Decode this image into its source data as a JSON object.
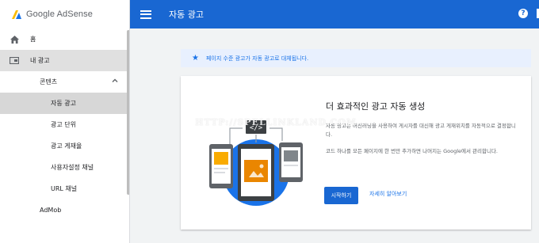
{
  "brand": {
    "name": "Google AdSense"
  },
  "topbar": {
    "title": "자동 광고",
    "help": "?"
  },
  "sidebar": {
    "items": [
      {
        "label": "홈"
      },
      {
        "label": "내 광고"
      },
      {
        "label": "콘텐츠"
      },
      {
        "label": "자동 광고"
      },
      {
        "label": "광고 단위"
      },
      {
        "label": "광고 게재율"
      },
      {
        "label": "사용자설정 채널"
      },
      {
        "label": "URL 채널"
      },
      {
        "label": "AdMob"
      }
    ]
  },
  "banner": {
    "text": "페이지 수준 광고가 자동 광고로 대체됩니다."
  },
  "card": {
    "title": "더 효과적인 광고 자동 생성",
    "desc1": "자동 광고는 머신러닝을 사용하여 게시자를 대신해 광고 게재위치를 자동적으로 결정합니다.",
    "desc2": "코드 하나를 모든 페이지에 한 번만 추가하면 나머지는 Google에서 관리합니다.",
    "start_label": "시작하기",
    "learn_label": "자세히 알아보기"
  },
  "watermark": "HTTP://SPELLINKLAND.COM",
  "colors": {
    "primary": "#1967d2",
    "accent": "#1a73e8",
    "banner_bg": "#e8f0fe"
  }
}
